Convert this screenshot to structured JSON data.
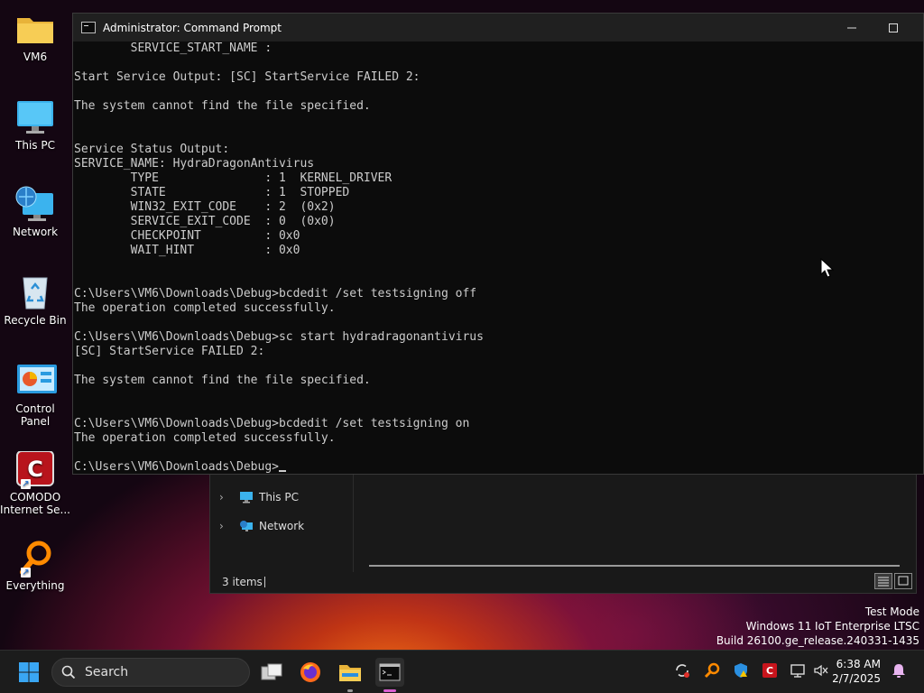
{
  "desktop": {
    "icons": [
      {
        "label": "VM6"
      },
      {
        "label": "This PC"
      },
      {
        "label": "Network"
      },
      {
        "label": "Recycle Bin"
      },
      {
        "label": "Control Panel"
      },
      {
        "label": "COMODO\nInternet Se..."
      },
      {
        "label": "Everything"
      }
    ]
  },
  "cmd": {
    "title": "Administrator: Command Prompt",
    "lines": [
      "        SERVICE_START_NAME :",
      "",
      "Start Service Output: [SC] StartService FAILED 2:",
      "",
      "The system cannot find the file specified.",
      "",
      "",
      "Service Status Output:",
      "SERVICE_NAME: HydraDragonAntivirus",
      "        TYPE               : 1  KERNEL_DRIVER",
      "        STATE              : 1  STOPPED",
      "        WIN32_EXIT_CODE    : 2  (0x2)",
      "        SERVICE_EXIT_CODE  : 0  (0x0)",
      "        CHECKPOINT         : 0x0",
      "        WAIT_HINT          : 0x0",
      "",
      "",
      "C:\\Users\\VM6\\Downloads\\Debug>bcdedit /set testsigning off",
      "The operation completed successfully.",
      "",
      "C:\\Users\\VM6\\Downloads\\Debug>sc start hydradragonantivirus",
      "[SC] StartService FAILED 2:",
      "",
      "The system cannot find the file specified.",
      "",
      "",
      "C:\\Users\\VM6\\Downloads\\Debug>bcdedit /set testsigning on",
      "The operation completed successfully.",
      "",
      "C:\\Users\\VM6\\Downloads\\Debug>"
    ]
  },
  "explorer": {
    "nav": [
      {
        "label": "This PC",
        "icon": "monitor-icon"
      },
      {
        "label": "Network",
        "icon": "network-icon"
      }
    ],
    "status": "3 items"
  },
  "watermark": {
    "line1": "Test Mode",
    "line2": "Windows 11 IoT Enterprise LTSC",
    "line3": "Build 26100.ge_release.240331-1435"
  },
  "taskbar": {
    "search_label": "Search",
    "time": "6:38 AM",
    "date": "2/7/2025"
  },
  "colors": {
    "console_bg": "#0c0c0c",
    "console_text": "#cccccc",
    "taskbar_bg": "#1c1c1c",
    "accent": "#1a8fe3"
  }
}
